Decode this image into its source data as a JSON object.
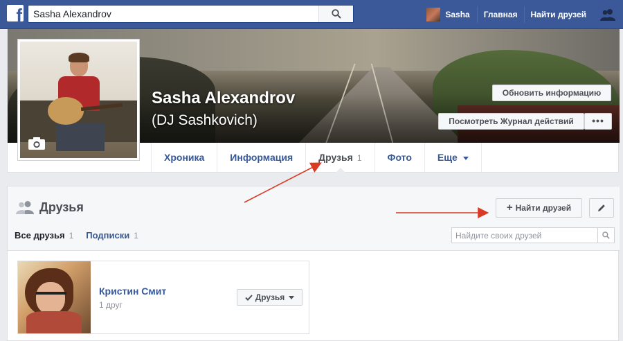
{
  "topbar": {
    "search_value": "Sasha Alexandrov",
    "user_name": "Sasha",
    "home_label": "Главная",
    "find_friends_label": "Найти друзей"
  },
  "profile": {
    "name": "Sasha Alexandrov",
    "alt_name": "(DJ Sashkovich)",
    "update_info_label": "Обновить информацию",
    "activity_log_label": "Посмотреть Журнал действий",
    "more_label": "•••"
  },
  "tabs": {
    "timeline": "Хроника",
    "about": "Информация",
    "friends": "Друзья",
    "friends_count": "1",
    "photos": "Фото",
    "more": "Еще"
  },
  "friends_section": {
    "title": "Друзья",
    "find_friends_label": "Найти друзей",
    "all_friends_label": "Все друзья",
    "all_friends_count": "1",
    "following_label": "Подписки",
    "following_count": "1",
    "search_placeholder": "Найдите своих друзей"
  },
  "friends": [
    {
      "name": "Кристин Смит",
      "mutual": "1 друг",
      "button_label": "Друзья"
    }
  ],
  "colors": {
    "brand": "#3b5998",
    "link": "#365899",
    "annotation_arrow": "#d93a24"
  },
  "icons": [
    "facebook-logo",
    "search-icon",
    "friend-requests-icon",
    "camera-icon",
    "friends-icon",
    "plus-icon",
    "pencil-icon",
    "check-icon",
    "chevron-down-icon"
  ]
}
